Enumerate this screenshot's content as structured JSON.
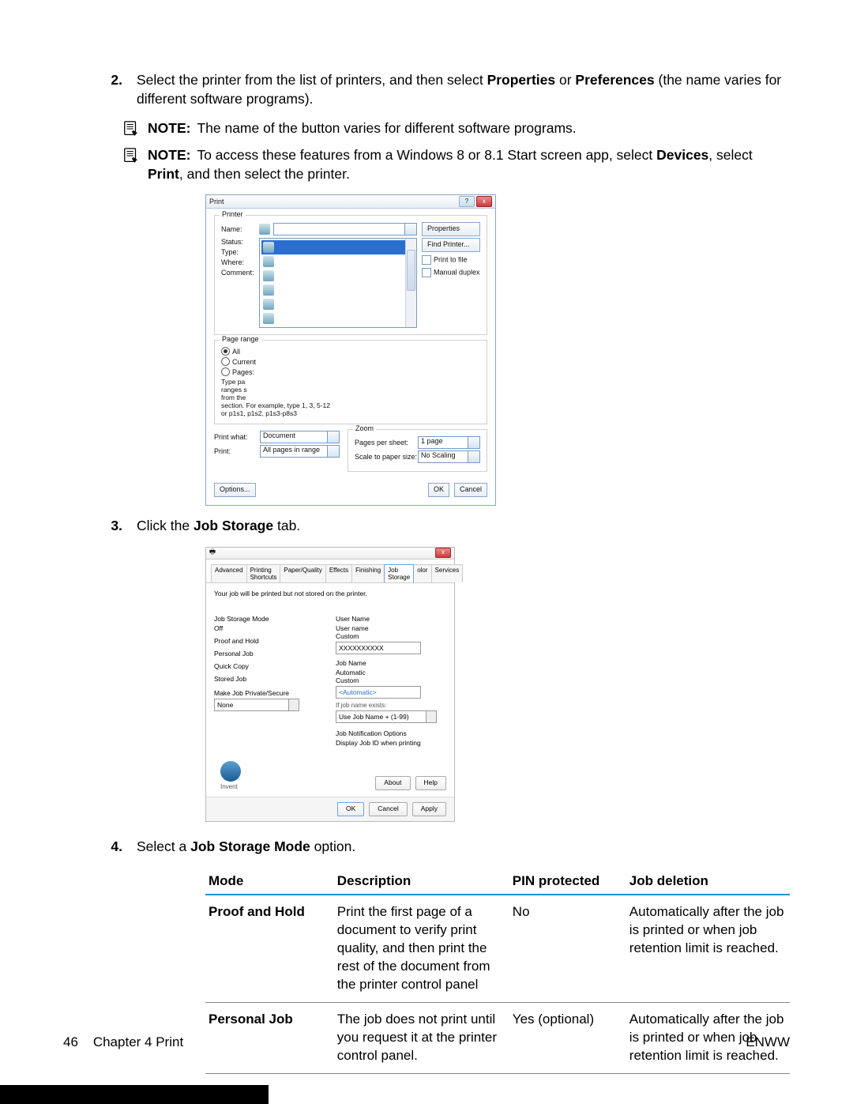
{
  "step2": {
    "num": "2.",
    "pre": "Select the printer from the list of printers, and then select ",
    "b1": "Properties",
    "or": " or ",
    "b2": "Preferences",
    "post": " (the name varies for different software programs)."
  },
  "note1": {
    "label": "NOTE:",
    "text": "The name of the button varies for different software programs."
  },
  "note2": {
    "label": "NOTE:",
    "pre": "To access these features from a Windows 8 or 8.1 Start screen app, select ",
    "b1": "Devices",
    "mid": ", select ",
    "b2": "Print",
    "post": ", and then select the printer."
  },
  "shot1": {
    "title": "Print",
    "printer": "Printer",
    "name": "Name:",
    "status": "Status:",
    "type": "Type:",
    "where": "Where:",
    "comment": "Comment:",
    "properties": "Properties",
    "findprinter": "Find Printer...",
    "printtofile": "Print to file",
    "manualduplex": "Manual duplex",
    "pagerange": "Page range",
    "all": "All",
    "current": "Current",
    "pages": "Pages:",
    "typepa": "Type pa",
    "rangess": "ranges s",
    "fromthe": "from the",
    "section": "section. For example, type 1, 3, 5-12",
    "orpsis": "or p1s1, p1s2, p1s3-p8s3",
    "printwhat": "Print what:",
    "document": "Document",
    "print": "Print:",
    "allpages": "All pages in range",
    "zoom": "Zoom",
    "ppsheet": "Pages per sheet:",
    "onepage": "1 page",
    "scale": "Scale to paper size:",
    "noscaling": "No Scaling",
    "options": "Options...",
    "ok": "OK",
    "cancel": "Cancel"
  },
  "step3": {
    "num": "3.",
    "pre": "Click the ",
    "b1": "Job Storage",
    "post": " tab."
  },
  "shot2": {
    "tabs": [
      "Advanced",
      "Printing Shortcuts",
      "Paper/Quality",
      "Effects",
      "Finishing",
      "Job Storage",
      "olor",
      "Services"
    ],
    "hint": "Your job will be printed but not stored on the printer.",
    "jsm": "Job Storage Mode",
    "off": "Off",
    "proof": "Proof and Hold",
    "personal": "Personal Job",
    "quick": "Quick Copy",
    "stored": "Stored Job",
    "make": "Make Job Private/Secure",
    "none": "None",
    "username": "User Name",
    "un_user": "User name",
    "custom": "Custom",
    "xxxx": "XXXXXXXXXX",
    "jobname": "Job Name",
    "auto": "Automatic",
    "autoval": "<Automatic>",
    "ifexists": "If job name exists:",
    "usejob": "Use Job Name + (1-99)",
    "jno": "Job Notification Options",
    "display": "Display Job ID when printing",
    "about": "About",
    "help": "Help",
    "ok": "OK",
    "cancel": "Cancel",
    "apply": "Apply",
    "Invent": "Invent"
  },
  "step4": {
    "num": "4.",
    "pre": "Select a ",
    "b1": "Job Storage Mode",
    "post": " option."
  },
  "table": {
    "headers": [
      "Mode",
      "Description",
      "PIN protected",
      "Job deletion"
    ],
    "rows": [
      {
        "mode": "Proof and Hold",
        "desc": "Print the first page of a document to verify print quality, and then print the rest of the document from the printer control panel",
        "pin": "No",
        "del": "Automatically after the job is printed or when job retention limit is reached."
      },
      {
        "mode": "Personal Job",
        "desc": "The job does not print until you request it at the printer control panel.",
        "pin": "Yes (optional)",
        "del": "Automatically after the job is printed or when job retention limit is reached."
      }
    ]
  },
  "footer": {
    "pagenum": "46",
    "chapter": "Chapter 4   Print",
    "right": "ENWW"
  }
}
